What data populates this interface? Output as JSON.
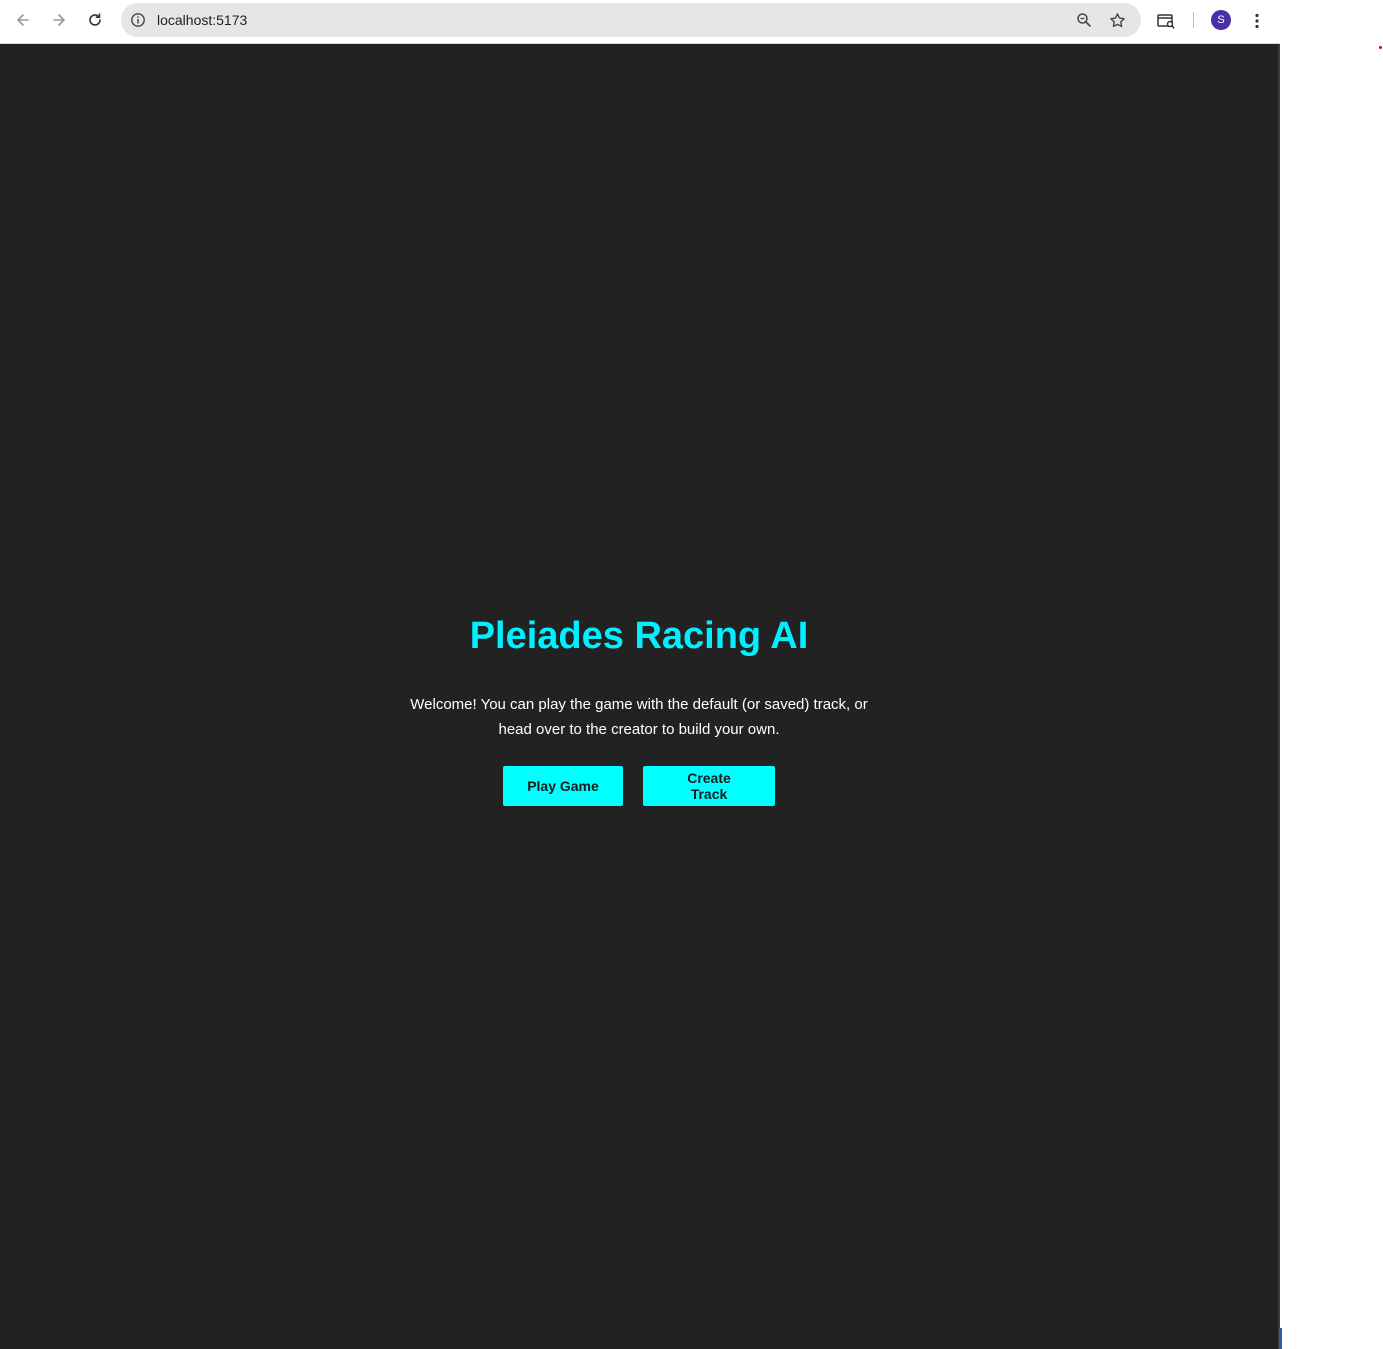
{
  "browser": {
    "url": "localhost:5173",
    "avatar_letter": "S"
  },
  "page": {
    "title": "Pleiades Racing AI",
    "description": "Welcome! You can play the game with the default (or saved) track, or head over to the creator to build your own.",
    "buttons": {
      "play": "Play Game",
      "create": "Create Track"
    }
  },
  "colors": {
    "accent": "#00ffff",
    "title": "#00f0ff",
    "background": "#222222"
  },
  "icons": {
    "back": "back-arrow-icon",
    "forward": "forward-arrow-icon",
    "reload": "reload-icon",
    "site_info": "info-icon",
    "zoom": "zoom-icon",
    "bookmark": "star-icon",
    "tab_search": "tab-search-icon",
    "menu": "kebab-menu-icon"
  }
}
